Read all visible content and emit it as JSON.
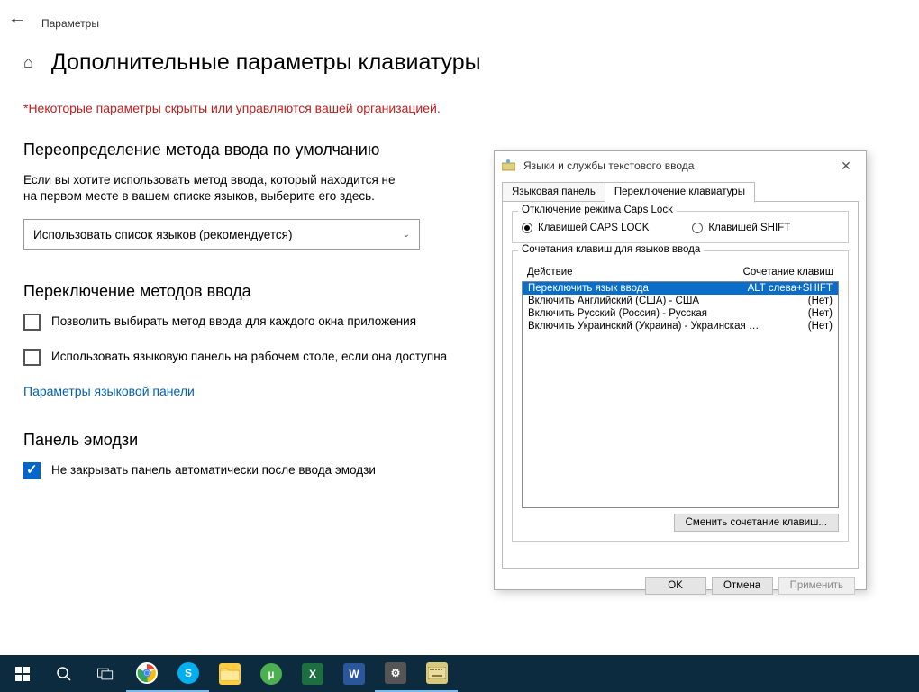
{
  "settings": {
    "window_title": "Параметры",
    "page_heading": "Дополнительные параметры клавиатуры",
    "warning": "*Некоторые параметры скрыты или управляются вашей организацией.",
    "sections": {
      "override": {
        "title": "Переопределение метода ввода по умолчанию",
        "desc": "Если вы хотите использовать метод ввода, который находится не на первом месте в вашем списке языков, выберите его здесь.",
        "dropdown": "Использовать список языков (рекомендуется)"
      },
      "switching": {
        "title": "Переключение методов ввода",
        "check1": "Позволить выбирать метод ввода для каждого окна приложения",
        "check2": "Использовать языковую панель на рабочем столе, если она доступна",
        "link": "Параметры языковой панели"
      },
      "emoji": {
        "title": "Панель эмодзи",
        "check1": "Не закрывать панель автоматически после ввода эмодзи"
      }
    }
  },
  "dialog": {
    "title": "Языки и службы текстового ввода",
    "tabs": {
      "lang_panel": "Языковая панель",
      "kb_switch": "Переключение клавиатуры"
    },
    "capslock": {
      "legend": "Отключение режима Caps Lock",
      "radio_caps": "Клавишей CAPS LOCK",
      "radio_shift": "Клавишей SHIFT"
    },
    "hotkeys": {
      "legend": "Сочетания клавиш для языков ввода",
      "col_action": "Действие",
      "col_combo": "Сочетание клавиш",
      "rows": [
        {
          "action": "Переключить язык ввода",
          "combo": "ALT слева+SHIFT",
          "selected": true
        },
        {
          "action": "Включить Английский (США) - США",
          "combo": "(Нет)",
          "selected": false
        },
        {
          "action": "Включить Русский (Россия) - Русская",
          "combo": "(Нет)",
          "selected": false
        },
        {
          "action": "Включить Украинский (Украина) - Украинская (расшир...",
          "combo": "(Нет)",
          "selected": false
        }
      ],
      "change_btn": "Сменить сочетание клавиш..."
    },
    "buttons": {
      "ok": "OK",
      "cancel": "Отмена",
      "apply": "Применить"
    }
  }
}
